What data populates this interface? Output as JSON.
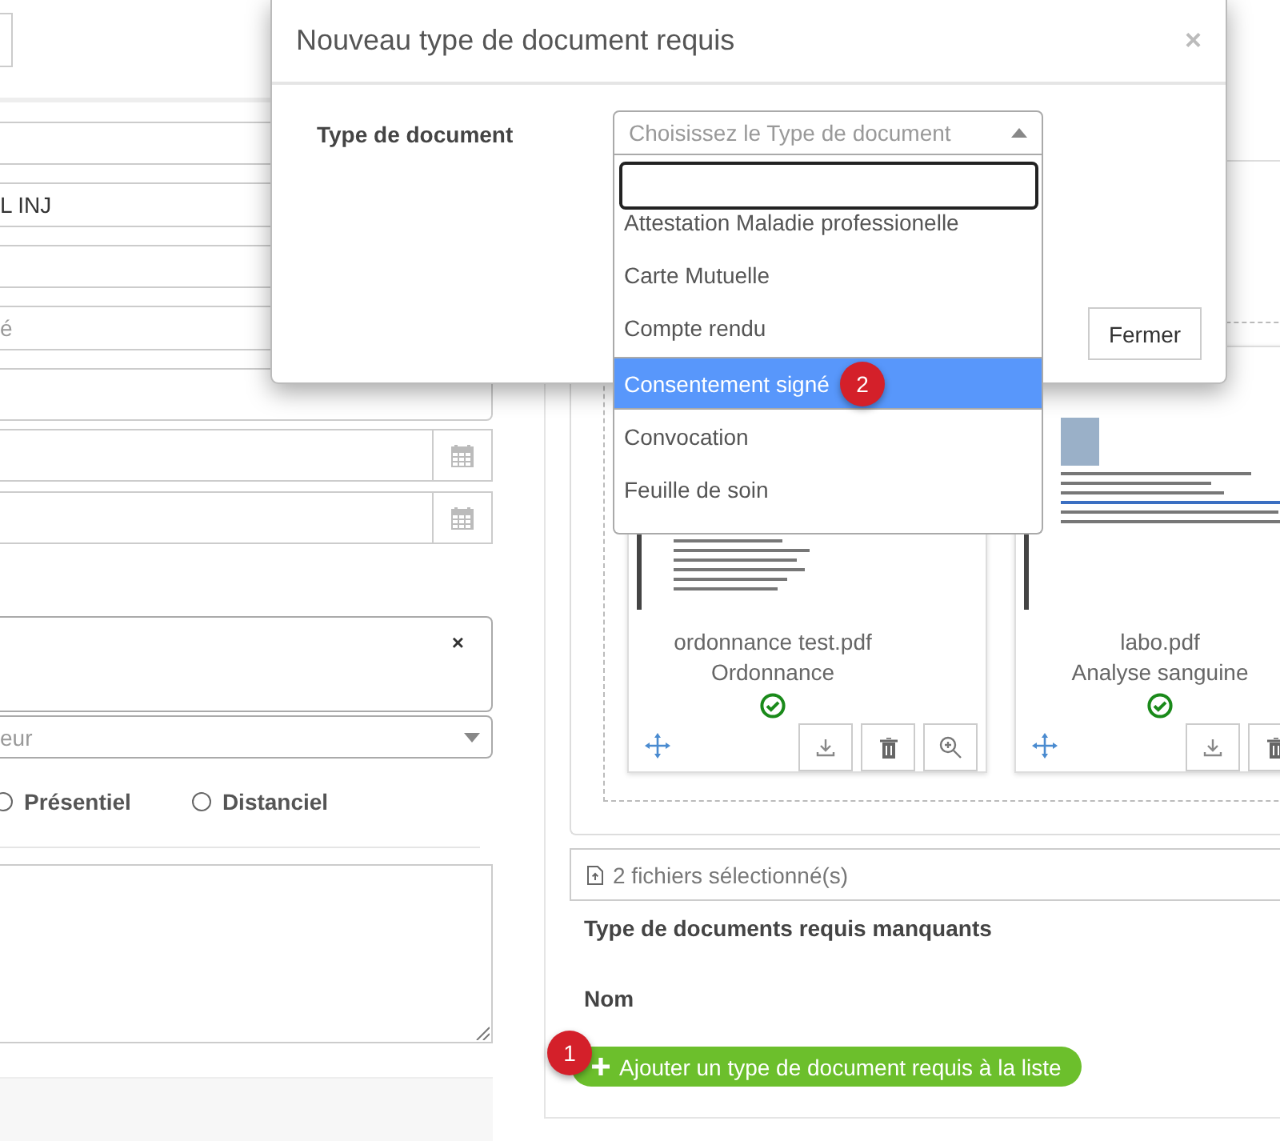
{
  "left_form": {
    "fields": [
      {
        "kind": "input"
      },
      {
        "kind": "input",
        "value": "L INJ"
      },
      {
        "kind": "input"
      },
      {
        "kind": "input",
        "placeholder": "é"
      },
      {
        "kind": "tall"
      },
      {
        "kind": "date"
      },
      {
        "kind": "date"
      }
    ],
    "multiselect": {
      "clear": "×"
    },
    "select": {
      "placeholder": "eur"
    },
    "radios": [
      {
        "label": "Présentiel",
        "selected": false
      },
      {
        "label": "Distanciel",
        "selected": false
      }
    ]
  },
  "files": [
    {
      "filename": "ordonnance test.pdf",
      "doc_type": "Ordonnance",
      "validated": true,
      "kind": "list"
    },
    {
      "filename": "labo.pdf",
      "doc_type": "Analyse sanguine",
      "validated": true,
      "kind": "letter"
    }
  ],
  "upload_summary": "2 fichiers sélectionné(s)",
  "missing_heading": "Type de documents requis manquants",
  "missing_column": "Nom",
  "add_button": {
    "label": "Ajouter un type de document requis à la liste",
    "badge": "1"
  },
  "modal": {
    "title": "Nouveau type de document requis",
    "close": "×",
    "field_label": "Type de document",
    "select_placeholder": "Choisissez le Type de document",
    "options": [
      {
        "label": "Attestation Maladie professionelle",
        "selected": false
      },
      {
        "label": "Carte Mutuelle",
        "selected": false
      },
      {
        "label": "Compte rendu",
        "selected": false
      },
      {
        "label": "Consentement signé",
        "selected": true,
        "badge": "2"
      },
      {
        "label": "Convocation",
        "selected": false
      },
      {
        "label": "Feuille de soin",
        "selected": false
      }
    ],
    "button": "Fermer"
  }
}
